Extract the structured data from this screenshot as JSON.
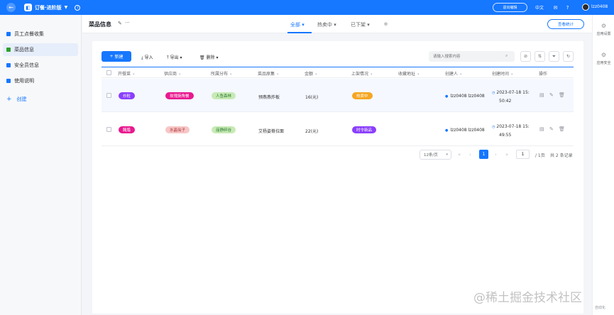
{
  "topbar": {
    "app_title": "订餐·进阶版",
    "exit_edit": "退出编辑",
    "lang": "中文",
    "username": "lzz0408"
  },
  "sidebar": {
    "items": [
      {
        "label": "员工点餐收集",
        "color": "#1677ff"
      },
      {
        "label": "菜品信息",
        "color": "#2ca02c"
      },
      {
        "label": "安全员信息",
        "color": "#1677ff"
      },
      {
        "label": "使用说明",
        "color": "#1677ff"
      }
    ],
    "create_label": "创建"
  },
  "rightbar": {
    "app_settings": "应用设置",
    "app_security": "应用安全",
    "automation": "自动化"
  },
  "header": {
    "page_title": "菜品信息",
    "tabs": [
      "全部",
      "热卖中",
      "已下架"
    ],
    "stats_button": "查看统计"
  },
  "toolbar": {
    "new_label": "新建",
    "import_label": "导入",
    "export_label": "导出",
    "delete_label": "删除",
    "search_placeholder": "请输入搜索内容"
  },
  "table": {
    "columns": [
      "开餐菜",
      "供应商",
      "所属分布",
      "菜品原集",
      "金额",
      "上架情况",
      "收藏地址",
      "创建人",
      "创建时间",
      "操作"
    ],
    "rows": [
      {
        "cat": "炒粒",
        "cat_color": "#8a3ffc",
        "supplier": "玫瑰豌角餐",
        "supplier_color": "#e8198f",
        "area": "人鱼森林",
        "area_bg": "#c7eab5",
        "area_fg": "#2e7d32",
        "dish": "预燕燕炸板",
        "amount": "16(元)",
        "status": "热卖中",
        "status_color": "#f5a623",
        "creator": "lzz0408 lzz0408",
        "created_1": "2023-07-18 15:",
        "created_2": "50:42"
      },
      {
        "cat": "腌腊",
        "cat_color": "#e8198f",
        "supplier": "水晶仙子",
        "supplier_color": "#f7c6c6",
        "supplier_fg": "#a33",
        "area": "庙静碎谷",
        "area_bg": "#c7eab5",
        "area_fg": "#2e7d32",
        "dish": "艾杨姿脊拉面",
        "amount": "22(元)",
        "status": "时令新品",
        "status_color": "#8a3ffc",
        "creator": "lzz0408 lzz0408",
        "created_1": "2023-07-18 15:",
        "created_2": "49:55"
      }
    ]
  },
  "pager": {
    "page_size": "12条/页",
    "current": "1",
    "jump": "1",
    "total_pages": "/ 1页",
    "total_records": "共 2 条记录"
  },
  "watermark": "@稀土掘金技术社区"
}
